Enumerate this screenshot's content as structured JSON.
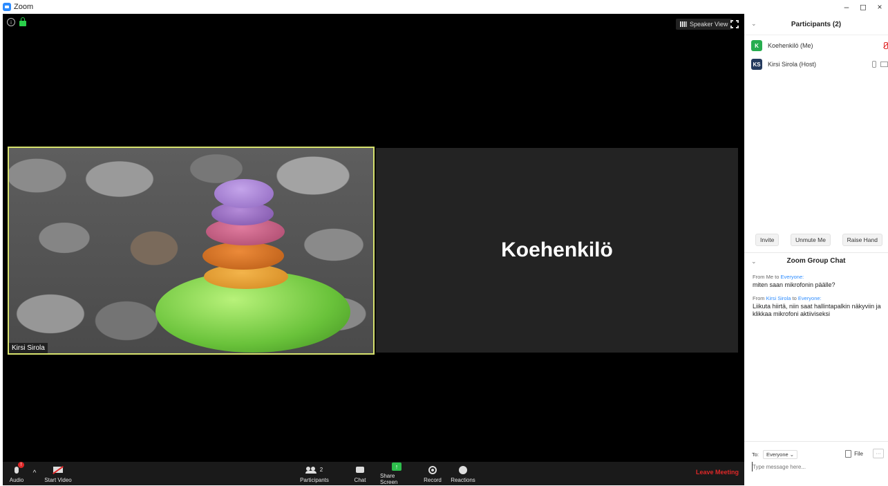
{
  "window": {
    "title": "Zoom",
    "controls": {
      "minimize": "–",
      "maximize": "◻",
      "close": "×"
    }
  },
  "meeting": {
    "view_label": "Speaker View",
    "left_tile_name": "Kirsi Sirola",
    "right_tile_name": "Koehenkilö"
  },
  "toolbar": {
    "audio": "Audio",
    "audio_badge": "!",
    "start_video": "Start Video",
    "participants": "Participants",
    "participants_count": "2",
    "chat": "Chat",
    "share_screen": "Share Screen",
    "record": "Record",
    "reactions": "Reactions",
    "leave": "Leave Meeting"
  },
  "panel": {
    "participants_title": "Participants (2)",
    "participants": [
      {
        "initials": "K",
        "name": "Koehenkilö (Me)",
        "avatar_color": "#27ad4f"
      },
      {
        "initials": "KS",
        "name": "Kirsi Sirola (Host)",
        "avatar_color": "#243a5e"
      }
    ],
    "buttons": {
      "invite": "Invite",
      "unmute": "Unmute Me",
      "raise_hand": "Raise Hand"
    },
    "chat_title": "Zoom Group Chat",
    "messages": [
      {
        "from_prefix": "From",
        "from": "Me",
        "to_prefix": "to",
        "to": "Everyone:",
        "text": "miten saan mikrofonin päälle?"
      },
      {
        "from_prefix": "From",
        "from": "Kirsi Sirola",
        "to_prefix": "to",
        "to": "Everyone:",
        "text": "Liikuta hiirtä, niin saat hallintapalkin näkyviin ja klikkaa mikrofoni aktiiviseksi"
      }
    ],
    "to_label": "To:",
    "to_value": "Everyone ⌄",
    "file_label": "File",
    "more_label": "···",
    "input_placeholder": "Type message here..."
  },
  "colors": {
    "leave": "#e02828",
    "accent": "#2d8cff",
    "share": "#2dbe4c"
  }
}
